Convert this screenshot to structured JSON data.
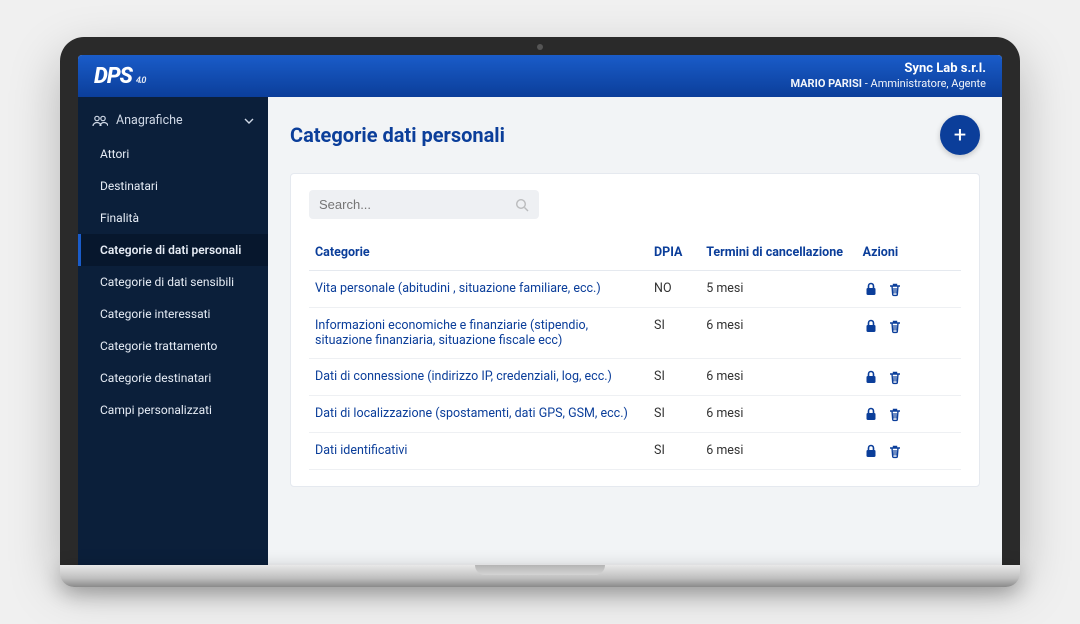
{
  "brand": {
    "logo": "DPS",
    "logo_sub": "4.0"
  },
  "tenant": {
    "company": "Sync Lab s.r.l.",
    "user": "MARIO PARISI",
    "roles": "Amministratore, Agente"
  },
  "sidebar": {
    "section_label": "Anagrafiche",
    "items": [
      {
        "label": "Attori"
      },
      {
        "label": "Destinatari"
      },
      {
        "label": "Finalità"
      },
      {
        "label": "Categorie di dati personali",
        "active": true
      },
      {
        "label": "Categorie di dati sensibili"
      },
      {
        "label": "Categorie interessati"
      },
      {
        "label": "Categorie trattamento"
      },
      {
        "label": "Categorie destinatari"
      },
      {
        "label": "Campi personalizzati"
      }
    ]
  },
  "main": {
    "title": "Categorie dati personali",
    "search_placeholder": "Search...",
    "columns": {
      "categorie": "Categorie",
      "dpia": "DPIA",
      "termini": "Termini di cancellazione",
      "azioni": "Azioni"
    },
    "rows": [
      {
        "categorie": "Vita personale (abitudini , situazione familiare, ecc.)",
        "dpia": "NO",
        "termini": "5 mesi"
      },
      {
        "categorie": "Informazioni economiche e finanziarie (stipendio, situazione finanziaria, situazione fiscale ecc)",
        "dpia": "SI",
        "termini": "6 mesi"
      },
      {
        "categorie": "Dati di connessione (indirizzo IP, credenziali, log, ecc.)",
        "dpia": "SI",
        "termini": "6 mesi"
      },
      {
        "categorie": "Dati di localizzazione (spostamenti, dati GPS, GSM, ecc.)",
        "dpia": "SI",
        "termini": "6 mesi"
      },
      {
        "categorie": "Dati identificativi",
        "dpia": "SI",
        "termini": "6 mesi"
      }
    ]
  },
  "icons": {
    "fab_plus": "+"
  }
}
